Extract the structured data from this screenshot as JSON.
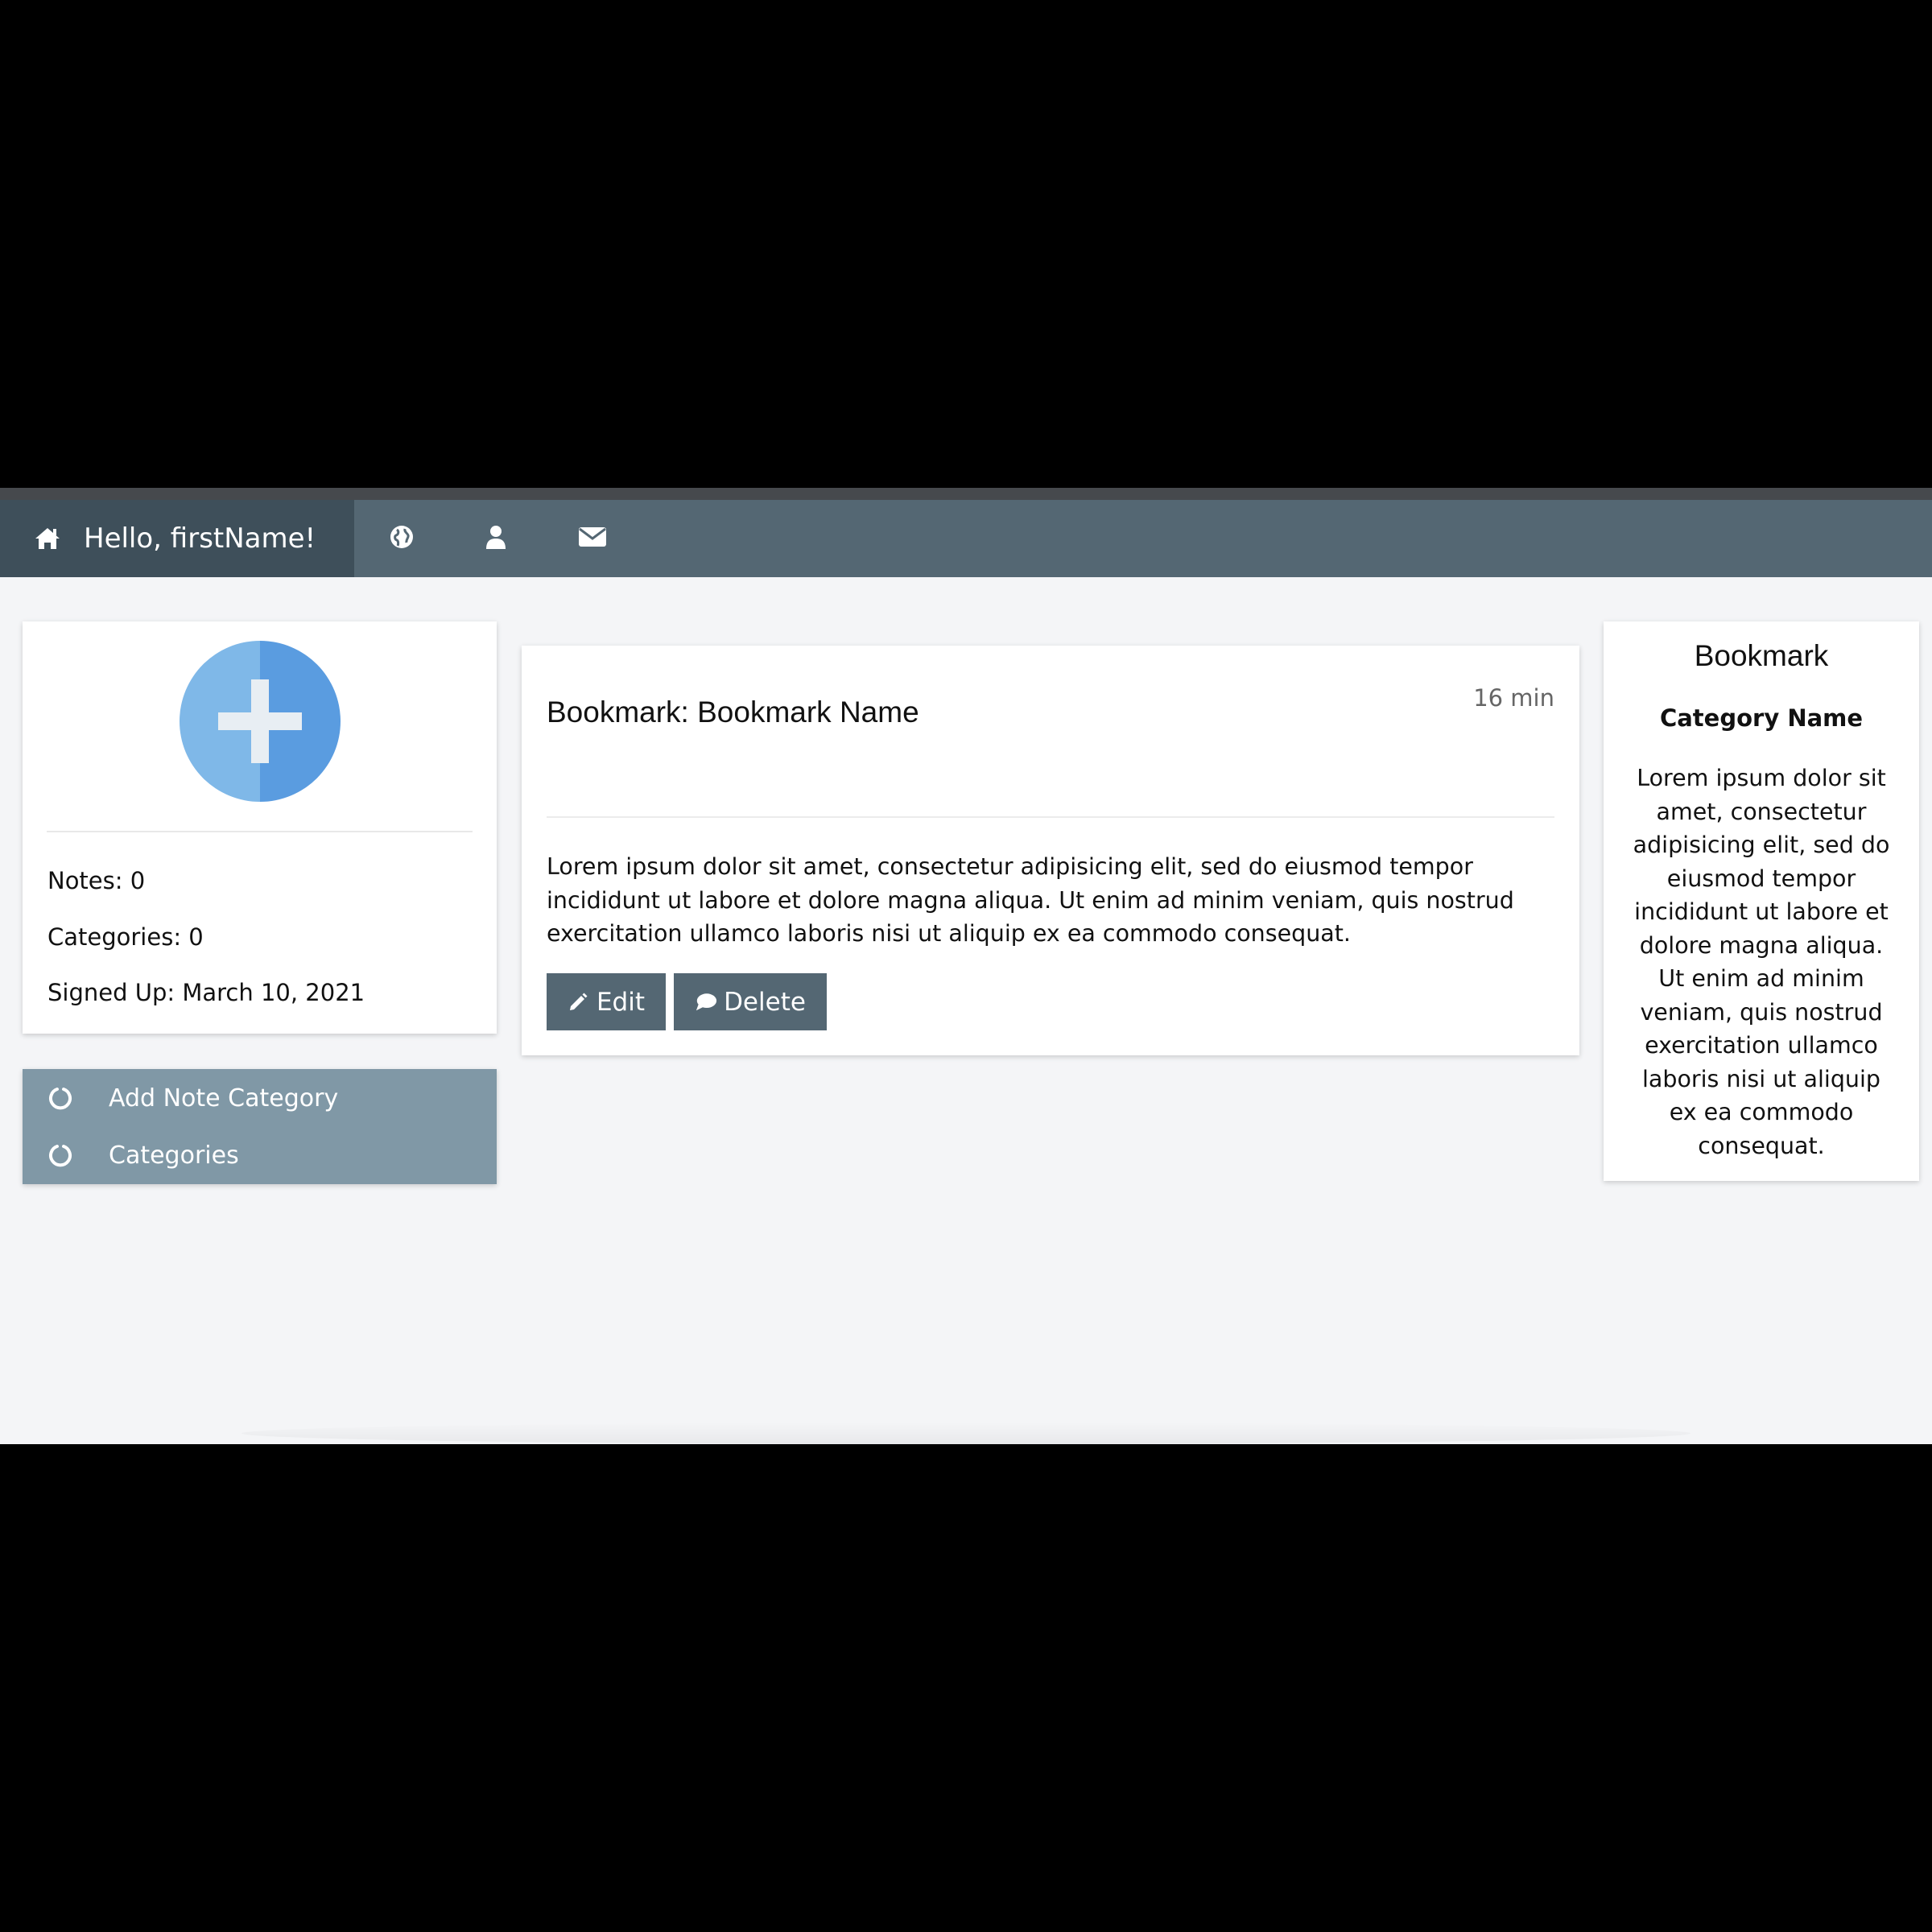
{
  "navbar": {
    "greeting": "Hello, firstName!",
    "icons": [
      "home-icon",
      "globe-icon",
      "user-icon",
      "envelope-icon"
    ]
  },
  "profile": {
    "notes": "Notes: 0",
    "categories": "Categories: 0",
    "signed_up": "Signed Up: March 10, 2021"
  },
  "menu": {
    "items": [
      {
        "label": "Add Note Category",
        "icon": "circle-notch-icon"
      },
      {
        "label": "Categories",
        "icon": "circle-notch-icon"
      }
    ]
  },
  "bookmark": {
    "title": "Bookmark: Bookmark Name",
    "time": "16 min",
    "body": "Lorem ipsum dolor sit amet, consectetur adipisicing elit, sed do eiusmod tempor incididunt ut labore et dolore magna aliqua. Ut enim ad minim veniam, quis nostrud exercitation ullamco laboris nisi ut aliquip ex ea commodo consequat.",
    "edit_label": "Edit",
    "delete_label": "Delete"
  },
  "sidebar": {
    "title": "Bookmark",
    "category": "Category Name",
    "body": "Lorem ipsum dolor sit amet, consectetur adipisicing elit, sed do eiusmod tempor incididunt ut labore et dolore magna aliqua. Ut enim ad minim veniam, quis nostrud exercitation ullamco laboris nisi ut aliquip ex ea commodo consequat."
  },
  "colors": {
    "navbar": "#546773",
    "navbar_active": "#3e4f5a",
    "menu": "#8098a6",
    "button": "#546773",
    "page_bg": "#f4f5f7",
    "avatar_light": "#7fb8e8",
    "avatar_dark": "#5a9ce0"
  }
}
